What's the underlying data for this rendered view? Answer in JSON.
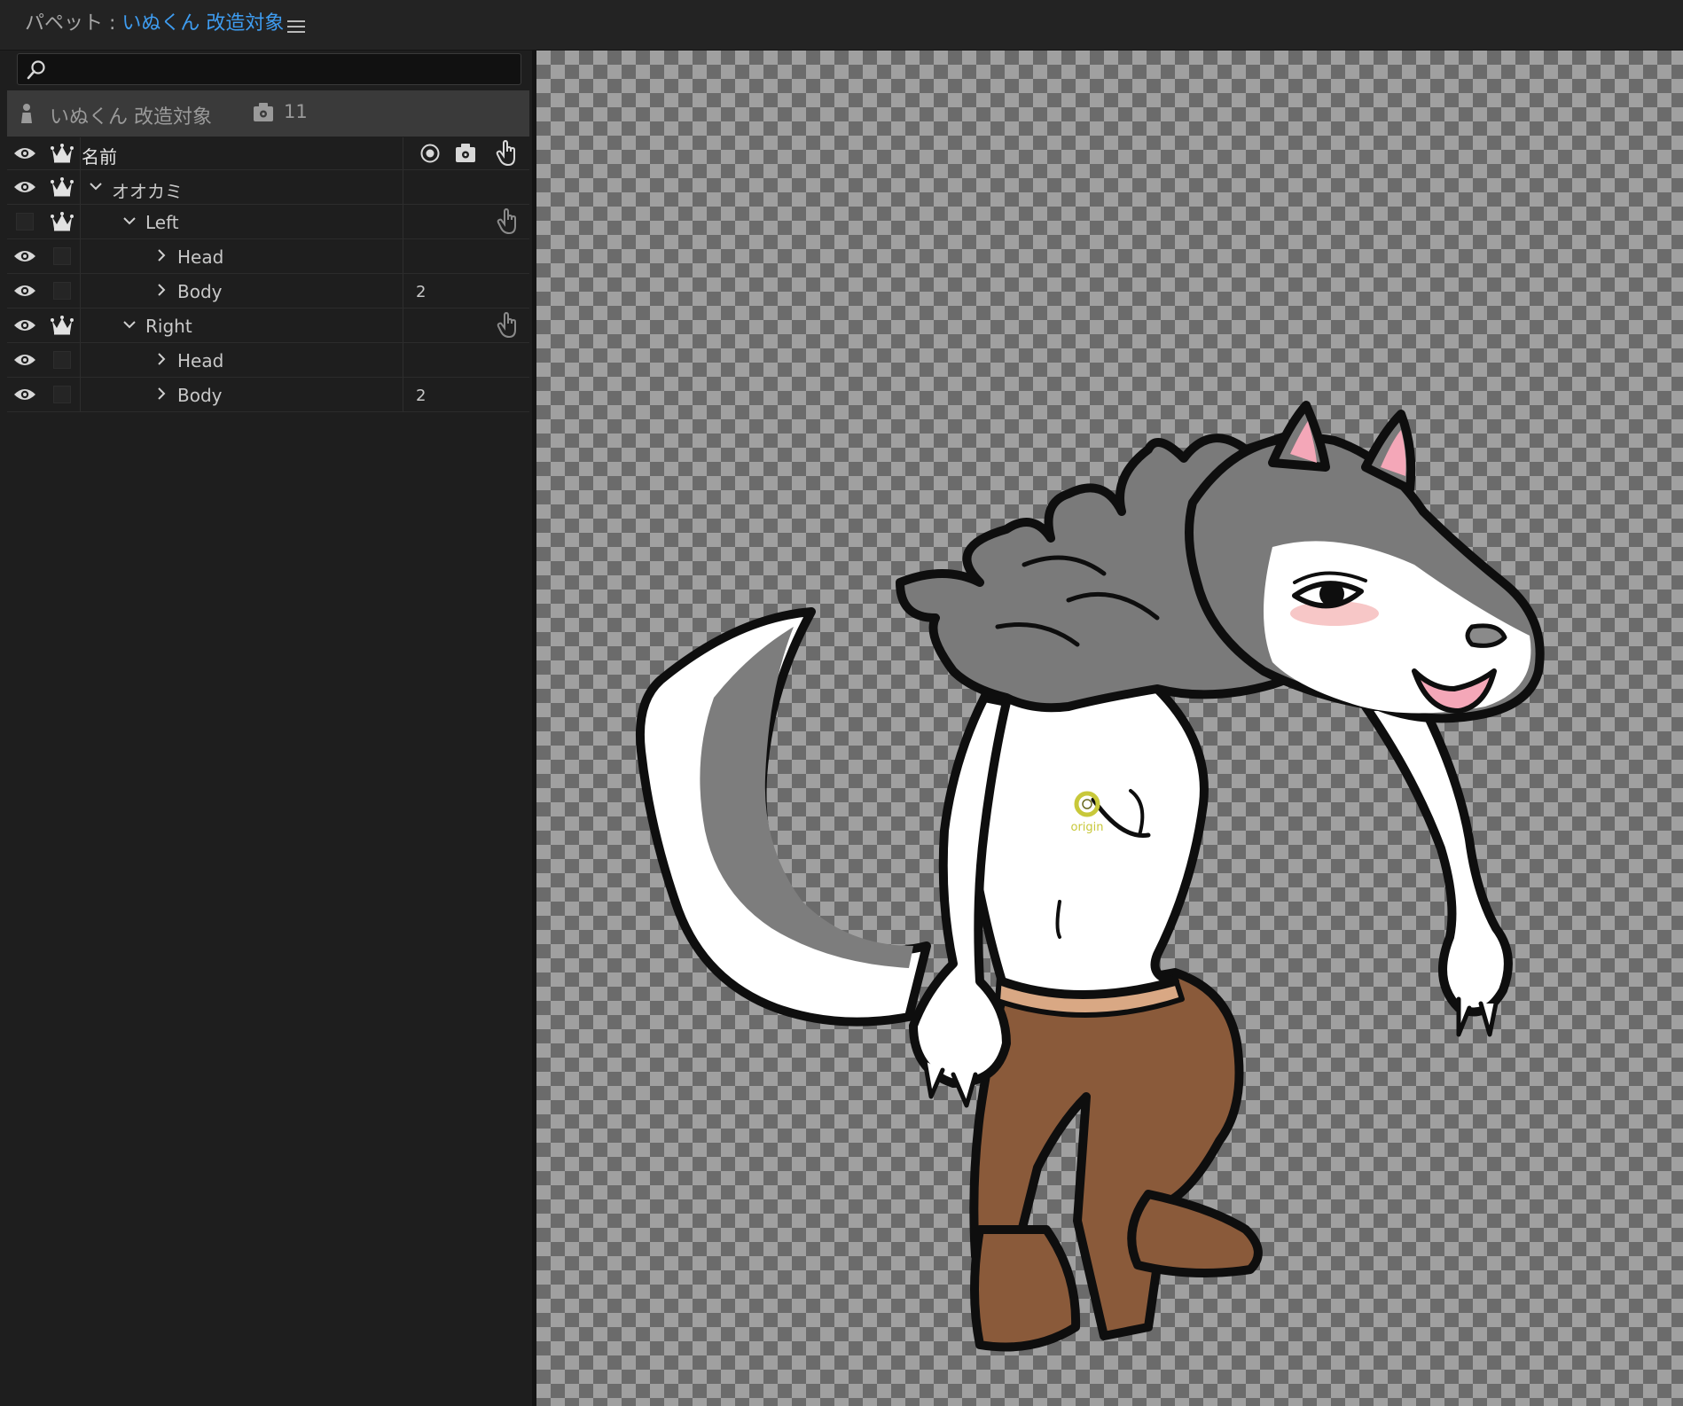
{
  "header": {
    "prefix": "パペット : ",
    "puppet_name": "いぬくん 改造対象"
  },
  "search": {
    "placeholder": "",
    "value": ""
  },
  "puppet_bar": {
    "name": "いぬくん 改造対象",
    "count": "11"
  },
  "columns": {
    "name": "名前"
  },
  "tree": [
    {
      "label": "オオカミ",
      "level": 0,
      "expanded": true,
      "visible": true,
      "crown": true,
      "count": "",
      "trigger": false
    },
    {
      "label": "Left",
      "level": 1,
      "expanded": true,
      "visible": false,
      "crown": true,
      "count": "",
      "trigger": true
    },
    {
      "label": "Head",
      "level": 2,
      "expanded": false,
      "visible": true,
      "crown": false,
      "count": "",
      "trigger": false
    },
    {
      "label": "Body",
      "level": 2,
      "expanded": false,
      "visible": true,
      "crown": false,
      "count": "2",
      "trigger": false
    },
    {
      "label": "Right",
      "level": 1,
      "expanded": true,
      "visible": true,
      "crown": true,
      "count": "",
      "trigger": true
    },
    {
      "label": "Head",
      "level": 2,
      "expanded": false,
      "visible": true,
      "crown": false,
      "count": "",
      "trigger": false
    },
    {
      "label": "Body",
      "level": 2,
      "expanded": false,
      "visible": true,
      "crown": false,
      "count": "2",
      "trigger": false
    }
  ],
  "canvas": {
    "origin_label": "origin"
  },
  "icons": {
    "menu": "hamburger-icon",
    "search": "search-icon",
    "puppet": "puppet-icon",
    "behaviors": "behaviors-icon",
    "visibility": "eye-icon",
    "independence": "crown-icon",
    "tag": "target-icon",
    "trigger": "hand-icon"
  },
  "colors": {
    "accent": "#3e9cf0",
    "origin": "#c8c83a",
    "pants": "#8a5a3a",
    "fur_gray": "#7a7a7a"
  }
}
